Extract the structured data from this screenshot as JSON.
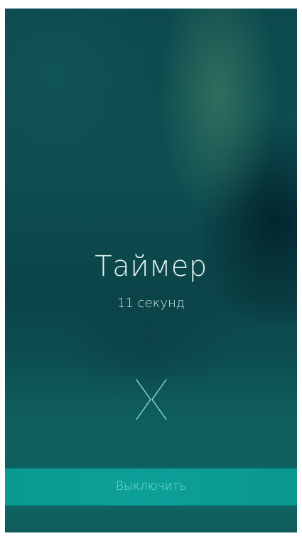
{
  "alarm": {
    "title": "Таймер",
    "subtitle": "11 секунд"
  },
  "dismiss": {
    "icon": "close-icon",
    "label": "Выключить"
  },
  "colors": {
    "accent": "#0c9f98",
    "title_text": "#e4f5f2",
    "action_text": "#7fded4"
  }
}
